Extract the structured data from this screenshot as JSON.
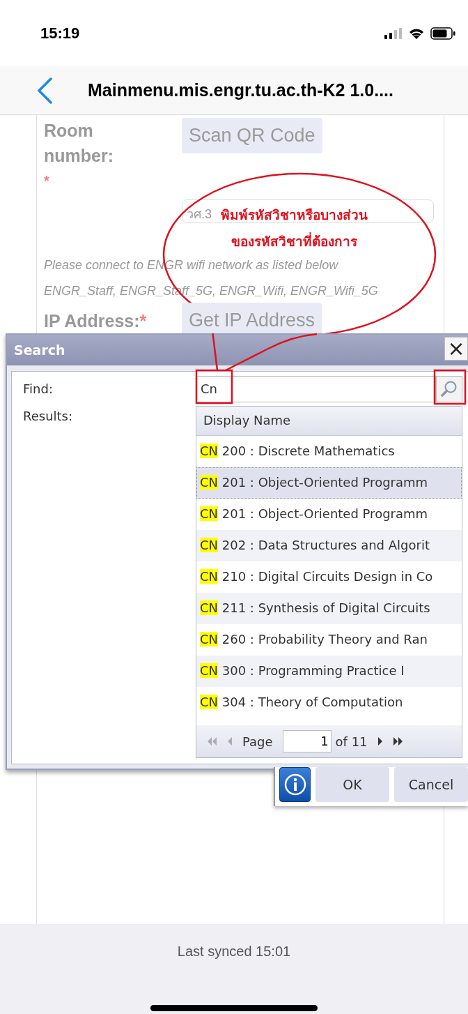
{
  "status_bar": {
    "time": "15:19"
  },
  "nav": {
    "title": "Mainmenu.mis.engr.tu.ac.th-K2 1.0...."
  },
  "form": {
    "room_label": "Room number:",
    "room_required": "*",
    "scan_button": "Scan QR Code",
    "room_value": "วศ.3",
    "wifi_note": "Please connect to ENGR wifi network  as listed below",
    "wifi_list": "ENGR_Staff, ENGR_Staff_5G, ENGR_Wifi, ENGR_Wifi_5G",
    "ip_label": "IP Address:",
    "ip_required": "*",
    "ip_button": "Get IP Address"
  },
  "callout": {
    "lines": [
      "พิมพ์รหัสวิชาหรือบางส่วน",
      "ของรหัสวิชาที่ต้องการ"
    ]
  },
  "dialog": {
    "title": "Search",
    "close": "×",
    "find_label": "Find:",
    "find_value": "Cn",
    "results_label": "Results:",
    "column": "Display Name",
    "rows": [
      {
        "match": "CN",
        "rest": "200 : Discrete Mathematics",
        "selected": false
      },
      {
        "match": "CN",
        "rest": "201 : Object-Oriented Programm",
        "selected": true
      },
      {
        "match": "CN",
        "rest": "201 : Object-Oriented Programm",
        "selected": false
      },
      {
        "match": "CN",
        "rest": "202 : Data Structures and Algorit",
        "selected": false
      },
      {
        "match": "CN",
        "rest": "210 : Digital Circuits Design in Co",
        "selected": false
      },
      {
        "match": "CN",
        "rest": "211 : Synthesis of Digital Circuits",
        "selected": false
      },
      {
        "match": "CN",
        "rest": "260 : Probability Theory and Ran",
        "selected": false
      },
      {
        "match": "CN",
        "rest": "300 : Programming Practice I",
        "selected": false
      },
      {
        "match": "CN",
        "rest": "304 : Theory of Computation",
        "selected": false
      }
    ],
    "pager": {
      "label": "Page",
      "page": "1",
      "of": "of 11"
    },
    "buttons": [
      "OK",
      "Cancel"
    ]
  },
  "footer": {
    "text": "Last synced 15:01"
  }
}
